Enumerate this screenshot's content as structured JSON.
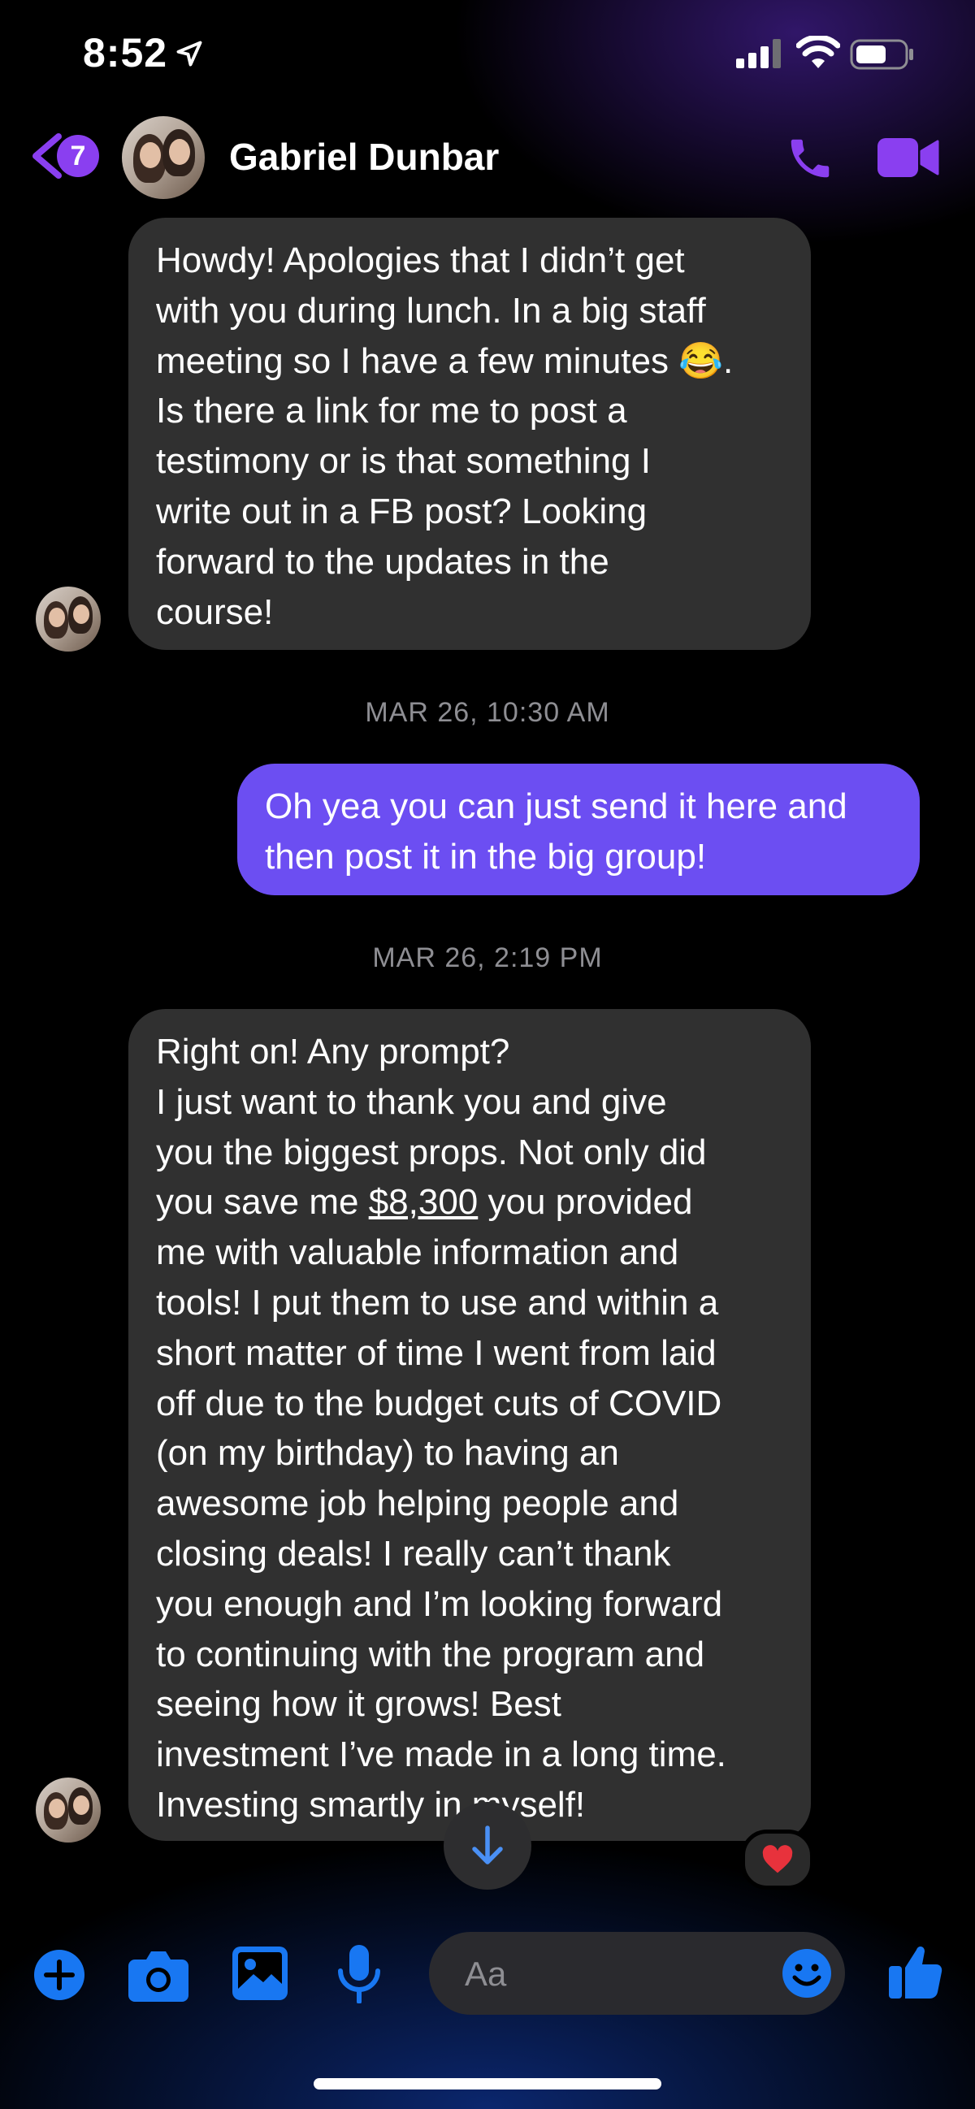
{
  "status_bar": {
    "time": "8:52"
  },
  "header": {
    "back_badge": "7",
    "contact_name": "Gabriel Dunbar"
  },
  "messages": [
    {
      "direction": "incoming",
      "text": "Howdy! Apologies that I didn’t get\nwith you during lunch. In a big staff\nmeeting so I have a few minutes 😂.\nIs there a link for me to post a\ntestimony or is that something I\nwrite out in a FB post? Looking\nforward to the updates in the\ncourse!"
    },
    {
      "direction": "timestamp",
      "text": "MAR 26, 10:30 AM"
    },
    {
      "direction": "outgoing",
      "text": "Oh yea you can just send it here and\nthen post it in the big group!"
    },
    {
      "direction": "timestamp",
      "text": "MAR 26, 2:19 PM"
    },
    {
      "direction": "incoming",
      "text_before": "Right on! Any prompt?\nI just want to thank you and give\nyou the biggest props. Not only did\nyou save me ",
      "amount": "$8,300",
      "text_after": " you provided\nme with valuable information and\ntools! I put them to use and within a\nshort matter of time I went from laid\noff due to the budget cuts of COVID\n(on my birthday) to having an\nawesome job helping people and\nclosing deals! I really can’t thank\nyou enough and I’m looking forward\nto continuing with the program and\nseeing how it grows! Best\ninvestment I’ve made in a long time.\nInvesting smartly in myself!",
      "reaction": "❤️"
    }
  ],
  "composer": {
    "placeholder": "Aa"
  },
  "icons": {
    "back": "chevron-left-icon",
    "call": "phone-icon",
    "video": "video-camera-icon",
    "plus": "plus-circle-icon",
    "camera": "camera-icon",
    "gallery": "image-icon",
    "mic": "microphone-icon",
    "emoji": "smiley-icon",
    "like": "thumbs-up-icon",
    "scroll": "arrow-down-icon"
  },
  "colors": {
    "accent_purple": "#8a3ff0",
    "outgoing_bubble": "#6c4ef2",
    "incoming_bubble": "#303030",
    "composer_blue": "#1877f2"
  }
}
